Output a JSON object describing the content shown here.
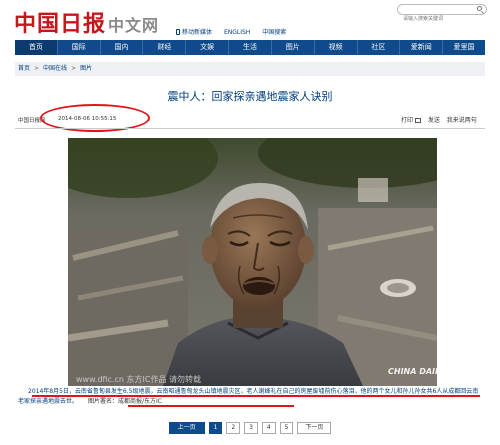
{
  "header": {
    "logo_text": "中国日报",
    "site_name": "中文网",
    "mobile_link": "移动新媒体",
    "english_link": "ENGLISH",
    "search_link": "中国搜索",
    "search_placeholder": "请输入搜索关键词"
  },
  "nav": {
    "items": [
      {
        "label": "首页"
      },
      {
        "label": "国际"
      },
      {
        "label": "国内"
      },
      {
        "label": "财经"
      },
      {
        "label": "文娱"
      },
      {
        "label": "生活"
      },
      {
        "label": "图片"
      },
      {
        "label": "视频"
      },
      {
        "label": "社区"
      },
      {
        "label": "爱新闻"
      },
      {
        "label": "爱里国"
      }
    ]
  },
  "breadcrumb": [
    "首页",
    "中国在线",
    "图片"
  ],
  "article": {
    "title": "震中人：回家探亲遇地震家人诀别",
    "source": "中国日报网",
    "datetime": "2014-08-06 10:55:15",
    "tools": {
      "print": "打印",
      "email": "发送",
      "comment": "我来说两句"
    },
    "photo_watermark": "www.dfic.cn 东方IC作品 请勿转载",
    "photo_badge": "CHINA DAILY",
    "caption": "2014年8月5日，云南省鲁甸县发生6.5级地震，云南昭通鲁甸龙头山镇地震灾区，老人谢峰礼在自己的房屋废墟前伤心落泪，他的两个女儿和孙儿孙女共6人从成都回云南老家探亲遇地震去世。",
    "caption_source": "图片署名：成都商报/东方IC"
  },
  "pagination": {
    "prev": "上一页",
    "pages": [
      "1",
      "2",
      "3",
      "4",
      "5"
    ],
    "current": "1",
    "next": "下一页"
  },
  "colors": {
    "brand_red": "#c4161c",
    "nav_blue": "#0f4a8a",
    "link_blue": "#003e7e",
    "annotation_red": "#e0141e"
  }
}
